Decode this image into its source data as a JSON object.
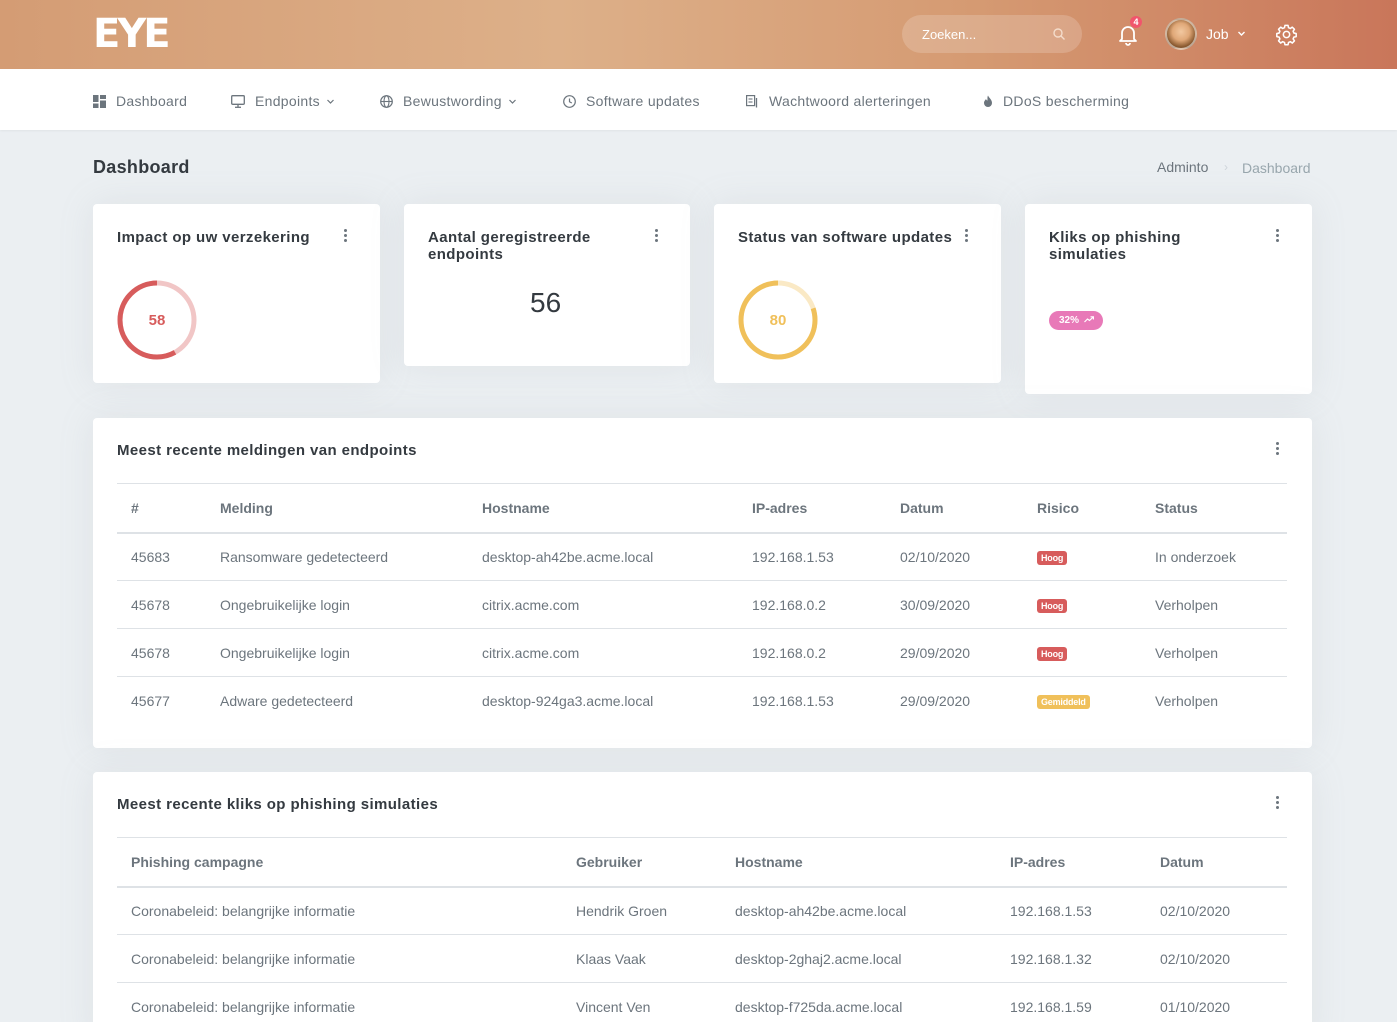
{
  "header": {
    "logo": "EYE",
    "search_placeholder": "Zoeken...",
    "notification_count": "4",
    "user_name": "Job"
  },
  "nav": [
    {
      "label": "Dashboard",
      "icon": "dashboard-icon"
    },
    {
      "label": "Endpoints",
      "icon": "monitor-icon",
      "dropdown": true
    },
    {
      "label": "Bewustwording",
      "icon": "globe-icon",
      "dropdown": true
    },
    {
      "label": "Software updates",
      "icon": "update-icon"
    },
    {
      "label": "Wachtwoord alerteringen",
      "icon": "password-icon"
    },
    {
      "label": "DDoS bescherming",
      "icon": "fire-icon"
    }
  ],
  "page": {
    "title": "Dashboard",
    "breadcrumb": [
      "Adminto",
      "Dashboard"
    ]
  },
  "widgets": {
    "insurance": {
      "title": "Impact op uw verzekering",
      "value": "58",
      "fraction": 0.58,
      "color": "#d75c5c"
    },
    "endpoints": {
      "title_line1": "Aantal geregistreerde",
      "title_line2": "endpoints",
      "value": "56"
    },
    "software": {
      "title": "Status van software updates",
      "value": "80",
      "fraction": 0.8,
      "color": "#f0c05a"
    },
    "phishing": {
      "title_line1": "Kliks op phishing",
      "title_line2": "simulaties",
      "pill": "32%",
      "pill_color": "#e879b8"
    }
  },
  "alerts": {
    "title": "Meest recente meldingen van endpoints",
    "columns": [
      "#",
      "Melding",
      "Hostname",
      "IP-adres",
      "Datum",
      "Risico",
      "Status"
    ],
    "rows": [
      {
        "id": "45683",
        "melding": "Ransomware gedetecteerd",
        "hostname": "desktop-ah42be.acme.local",
        "ip": "192.168.1.53",
        "datum": "02/10/2020",
        "risico": "Hoog",
        "status": "In onderzoek"
      },
      {
        "id": "45678",
        "melding": "Ongebruikelijke login",
        "hostname": "citrix.acme.com",
        "ip": "192.168.0.2",
        "datum": "30/09/2020",
        "risico": "Hoog",
        "status": "Verholpen"
      },
      {
        "id": "45678",
        "melding": "Ongebruikelijke login",
        "hostname": "citrix.acme.com",
        "ip": "192.168.0.2",
        "datum": "29/09/2020",
        "risico": "Hoog",
        "status": "Verholpen"
      },
      {
        "id": "45677",
        "melding": "Adware gedetecteerd",
        "hostname": "desktop-924ga3.acme.local",
        "ip": "192.168.1.53",
        "datum": "29/09/2020",
        "risico": "Gemiddeld",
        "status": "Verholpen"
      }
    ],
    "risk_colors": {
      "Hoog": "#d75c5c",
      "Gemiddeld": "#f0c05a"
    }
  },
  "phishing_clicks": {
    "title": "Meest recente kliks op phishing simulaties",
    "columns": [
      "Phishing campagne",
      "Gebruiker",
      "Hostname",
      "IP-adres",
      "Datum"
    ],
    "rows": [
      {
        "campagne": "Coronabeleid: belangrijke informatie",
        "gebruiker": "Hendrik Groen",
        "hostname": "desktop-ah42be.acme.local",
        "ip": "192.168.1.53",
        "datum": "02/10/2020"
      },
      {
        "campagne": "Coronabeleid: belangrijke informatie",
        "gebruiker": "Klaas Vaak",
        "hostname": "desktop-2ghaj2.acme.local",
        "ip": "192.168.1.32",
        "datum": "02/10/2020"
      },
      {
        "campagne": "Coronabeleid: belangrijke informatie",
        "gebruiker": "Vincent Ven",
        "hostname": "desktop-f725da.acme.local",
        "ip": "192.168.1.59",
        "datum": "01/10/2020"
      }
    ]
  }
}
